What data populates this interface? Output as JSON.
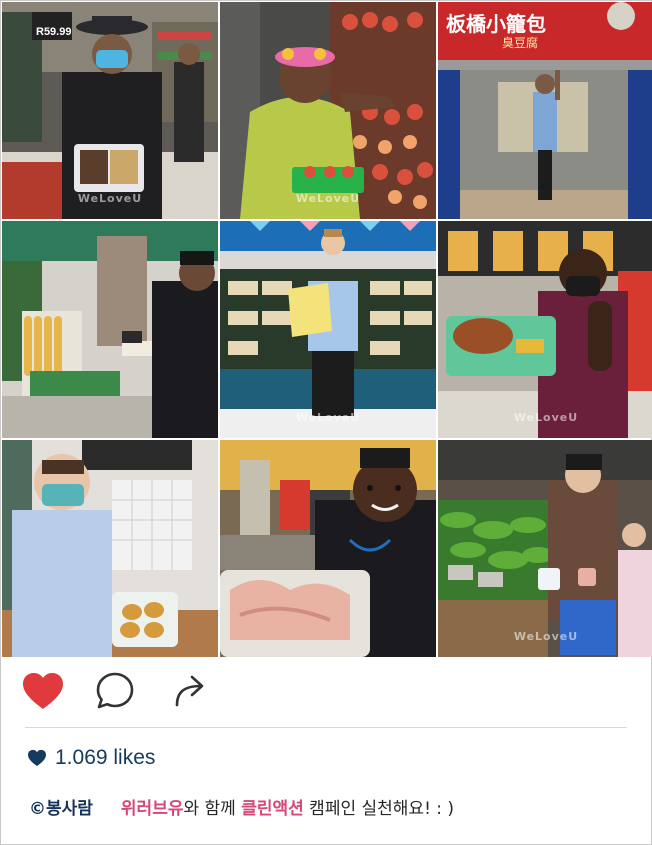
{
  "photos": [
    {
      "name": "photo-man-cake-box",
      "watermark": "WeLoveU"
    },
    {
      "name": "photo-woman-fruit-basket",
      "watermark": "WeLoveU"
    },
    {
      "name": "photo-man-shop-entrance",
      "sign_main": "板橋小籠包",
      "sign_sub": "臭豆腐",
      "watermark": ""
    },
    {
      "name": "photo-woman-snack-stall",
      "watermark": ""
    },
    {
      "name": "photo-man-shopping-bag",
      "watermark": "WeLoveU"
    },
    {
      "name": "photo-man-chicken-container",
      "watermark": "WeLoveU"
    },
    {
      "name": "photo-man-bread-container",
      "watermark": ""
    },
    {
      "name": "photo-woman-meat-container",
      "watermark": ""
    },
    {
      "name": "photo-woman-market-vegetables",
      "watermark": "WeLoveU"
    }
  ],
  "price_sign": "R59.99",
  "actions": {
    "like_icon": "heart-filled-icon",
    "comment_icon": "comment-bubble-icon",
    "share_icon": "share-arrow-icon",
    "like_color": "#e0393e"
  },
  "likes": {
    "icon": "small-heart-icon",
    "text": "1.069 likes",
    "color": "#163a5c"
  },
  "caption": {
    "user": "©봉사람",
    "part1": "위러브유",
    "part2": "와 함께 ",
    "part3": "클린액션",
    "part4": " 캠페인 실천해요! : )",
    "highlight_color": "#d6477a"
  }
}
